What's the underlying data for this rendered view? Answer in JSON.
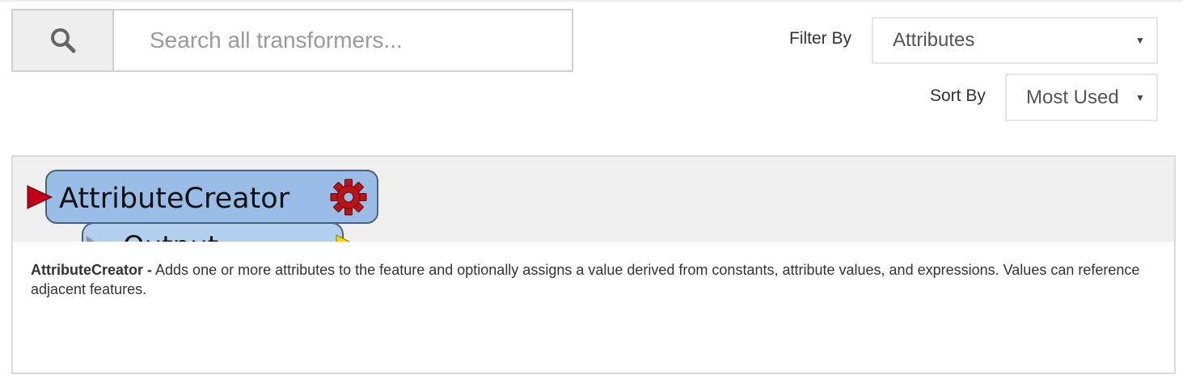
{
  "search": {
    "placeholder": "Search all transformers...",
    "icon": "search-icon"
  },
  "filter": {
    "label": "Filter By",
    "selected": "Attributes"
  },
  "sort": {
    "label": "Sort By",
    "selected": "Most Used"
  },
  "transformer": {
    "graphic_name": "AttributeCreator",
    "graphic_partial_port_label": "Output",
    "name": "AttributeCreator -",
    "description": "Adds one or more attributes to the feature and optionally assigns a value derived from constants, attribute values, and expressions. Values can reference adjacent features.",
    "colors": {
      "node_fill": "#99bde6",
      "node_border": "#4a6272",
      "input_port": "#c0001a",
      "gear": "#b8141c",
      "output_port": "#f5d21c"
    }
  }
}
